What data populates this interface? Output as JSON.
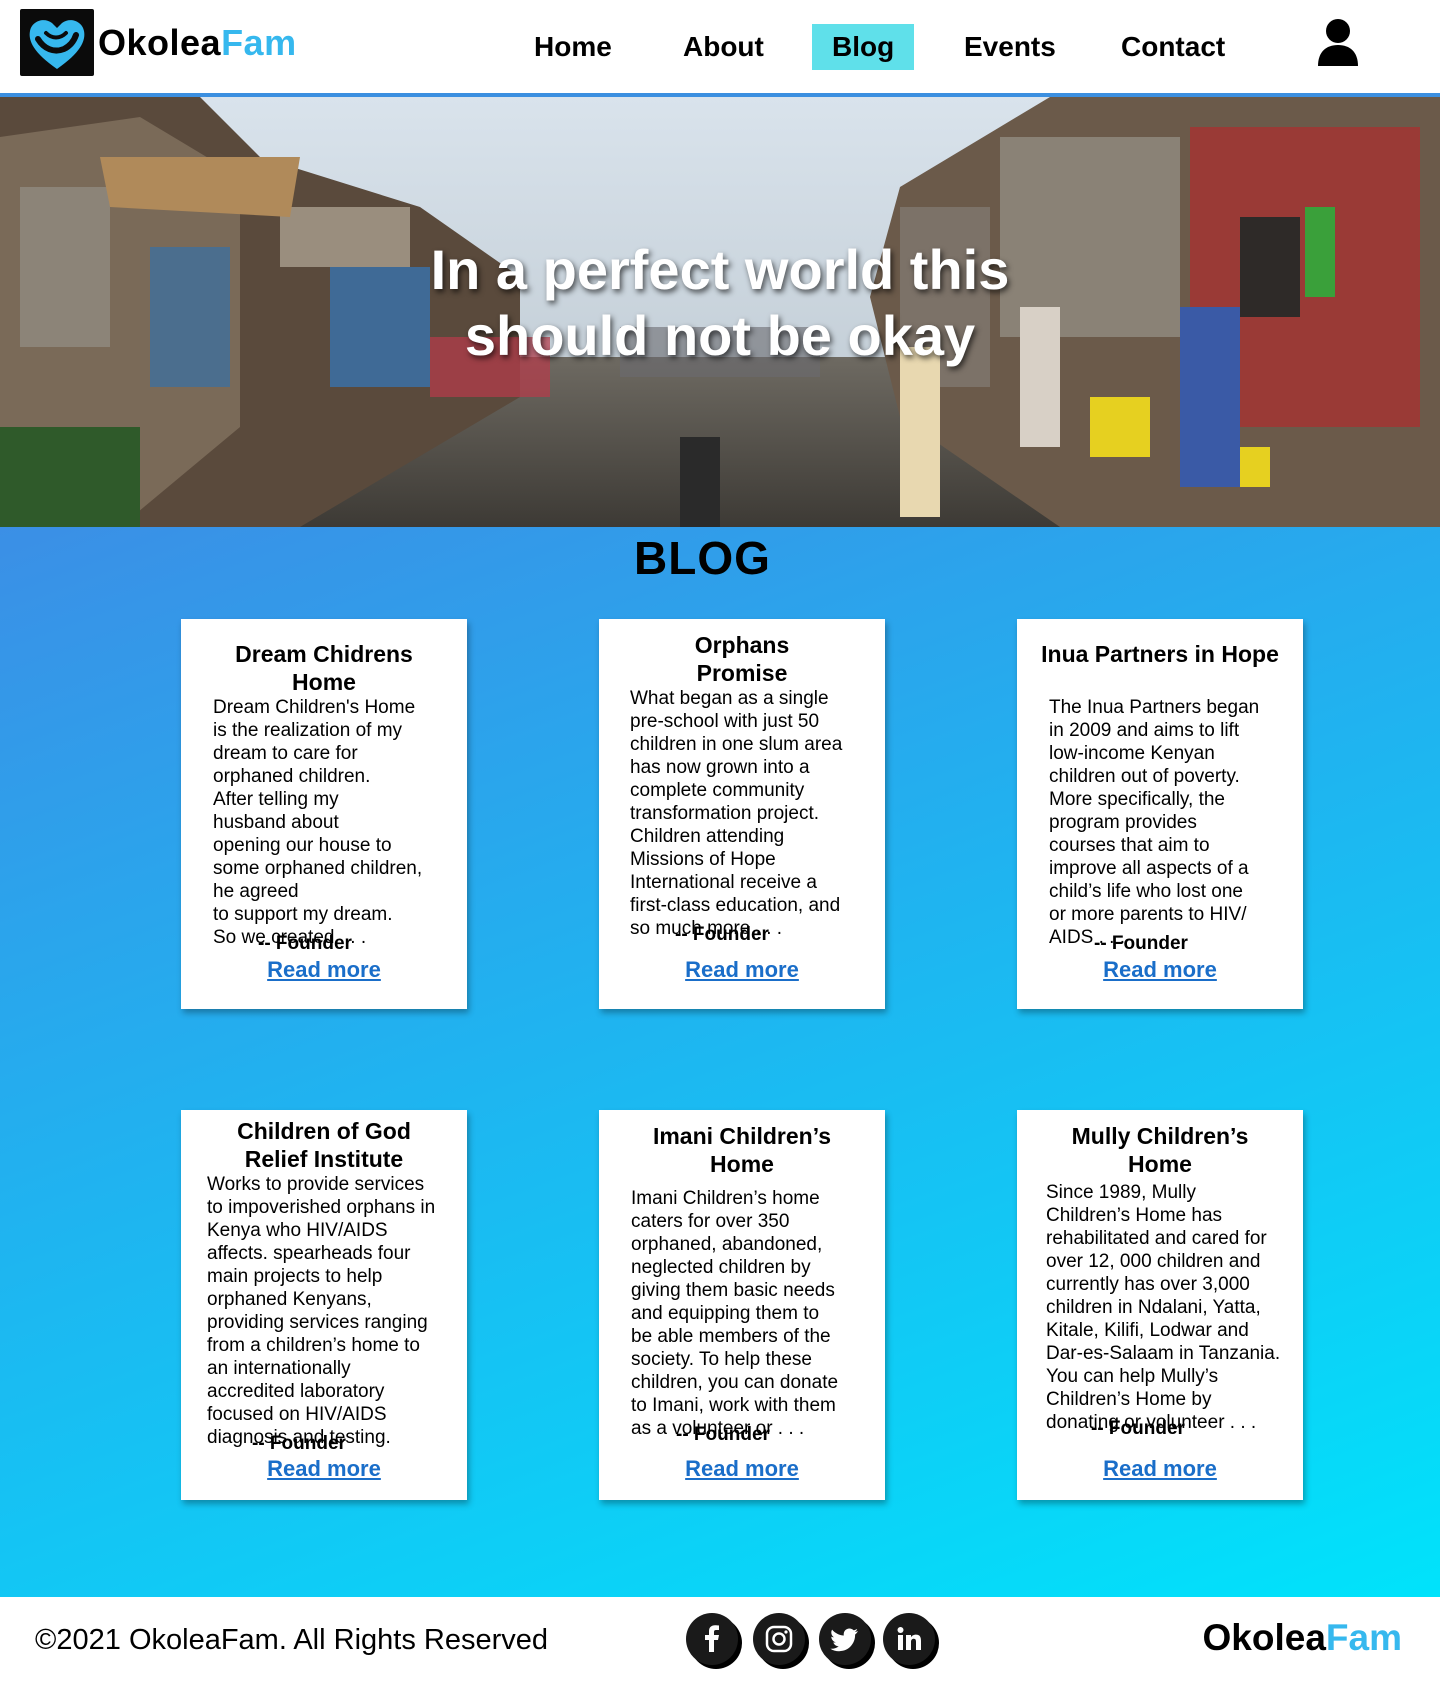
{
  "header": {
    "logo_main": "Okolea",
    "logo_accent": "Fam",
    "nav": [
      {
        "label": "Home"
      },
      {
        "label": "About"
      },
      {
        "label": "Blog"
      },
      {
        "label": "Events"
      },
      {
        "label": "Contact"
      }
    ],
    "active_nav": "Blog"
  },
  "hero": {
    "title_line1": "In a perfect  world this",
    "title_line2": "should not be okay"
  },
  "blog": {
    "title": "BLOG",
    "read_more_label": "Read more",
    "cards": [
      {
        "title": "Dream Chidrens Home",
        "body": "Dream Children's Home\nis the realization of my\ndream to care for\norphaned children.\nAfter telling my\nhusband about\nopening our house to\nsome orphaned children,\nhe agreed\nto support my dream.\nSo we created . . .",
        "author": "-- Founder",
        "link": "Read more"
      },
      {
        "title": "Orphans Promise",
        "body": "What began as a single\npre-school with just 50\nchildren in one slum area\nhas now grown into a\ncomplete community\ntransformation project.\nChildren attending\nMissions of Hope\nInternational receive a\nfirst-class education, and\nso much more . . .",
        "author": "-- Founder",
        "link": "Read more"
      },
      {
        "title": "Inua Partners in Hope",
        "body": "The Inua Partners began\nin 2009 and aims to lift\nlow-income Kenyan\nchildren out of poverty.\nMore specifically, the\nprogram provides\ncourses that aim to\nimprove all aspects of a\nchild’s life who lost one\nor more parents to HIV/\nAIDS . . .",
        "author": "-- Founder",
        "link": "Read more"
      },
      {
        "title": "Children of God Relief Institute",
        "body": "Works to provide services\nto impoverished orphans in\nKenya who HIV/AIDS\naffects. spearheads four\nmain projects to help\norphaned Kenyans,\nproviding services ranging\nfrom a children’s home to\nan internationally\naccredited laboratory\nfocused on HIV/AIDS\ndiagnosis and testing.",
        "author": "-- Founder",
        "link": "Read more"
      },
      {
        "title": "Imani Children’s Home",
        "body": "Imani Children’s home\ncaters for over 350\norphaned, abandoned,\nneglected children by\ngiving them basic needs\nand equipping them to\nbe able members of the\nsociety. To help these\nchildren, you can donate\nto Imani, work with them\nas a volunteer or . . .",
        "author": "-- Founder",
        "link": "Read more"
      },
      {
        "title": "Mully Children’s Home",
        "body": "Since 1989, Mully\nChildren’s Home has\nrehabilitated and cared for\nover 12, 000 children and\ncurrently has over 3,000\nchildren in Ndalani, Yatta,\nKitale, Kilifi, Lodwar and\nDar-es-Salaam in Tanzania.\nYou can help Mully’s\nChildren’s Home by\ndonating or volunteer . . .",
        "author": "-- Founder",
        "link": "Read more"
      }
    ]
  },
  "footer": {
    "copyright": "©2021 OkoleaFam. All Rights Reserved",
    "logo_main": "Okolea",
    "logo_accent": "Fam",
    "social": [
      {
        "icon": "facebook-icon",
        "glyph": "f"
      },
      {
        "icon": "instagram-icon",
        "glyph": ""
      },
      {
        "icon": "twitter-icon",
        "glyph": ""
      },
      {
        "icon": "linkedin-icon",
        "glyph": "in"
      }
    ]
  },
  "colors": {
    "accent": "#36b8ee",
    "nav_active": "#5fe0ea",
    "link": "#1a6ec9",
    "gradient_start": "#3b8fe6",
    "gradient_end": "#00e3fb"
  }
}
